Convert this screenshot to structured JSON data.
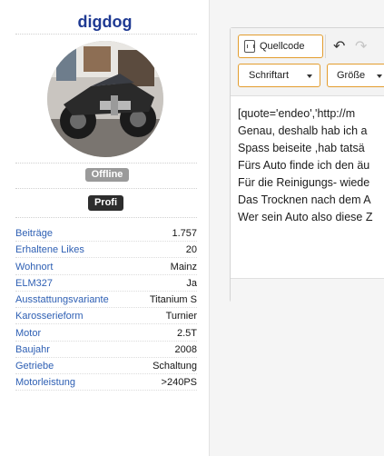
{
  "profile": {
    "username": "digdog",
    "status": "Offline",
    "rank": "Profi",
    "stats": [
      {
        "label": "Beiträge",
        "value": "1.757"
      },
      {
        "label": "Erhaltene Likes",
        "value": "20"
      },
      {
        "label": "Wohnort",
        "value": "Mainz"
      },
      {
        "label": "ELM327",
        "value": "Ja"
      },
      {
        "label": "Ausstattungsvariante",
        "value": "Titanium S"
      },
      {
        "label": "Karosserieform",
        "value": "Turnier"
      },
      {
        "label": "Motor",
        "value": "2.5T"
      },
      {
        "label": "Baujahr",
        "value": "2008"
      },
      {
        "label": "Getriebe",
        "value": "Schaltung"
      },
      {
        "label": "Motorleistung",
        "value": ">240PS"
      }
    ]
  },
  "editor": {
    "toolbar": {
      "source_label": "Quellcode",
      "font_label": "Schriftart",
      "size_label": "Größe"
    },
    "lines": [
      "[quote='endeo','http://m",
      "Genau, deshalb hab ich a",
      "Spass beiseite ,hab tatsä",
      "Fürs Auto finde ich den äu",
      "Für die Reinigungs- wiede",
      "Das Trocknen nach dem A",
      "Wer sein Auto also diese Z"
    ]
  },
  "colors": {
    "username": "#1f3a93",
    "stat_label": "#2f60b4",
    "toolbar_border": "#e39d2e",
    "offline_badge": "#9a9a9a",
    "rank_badge": "#2d2d2d"
  }
}
